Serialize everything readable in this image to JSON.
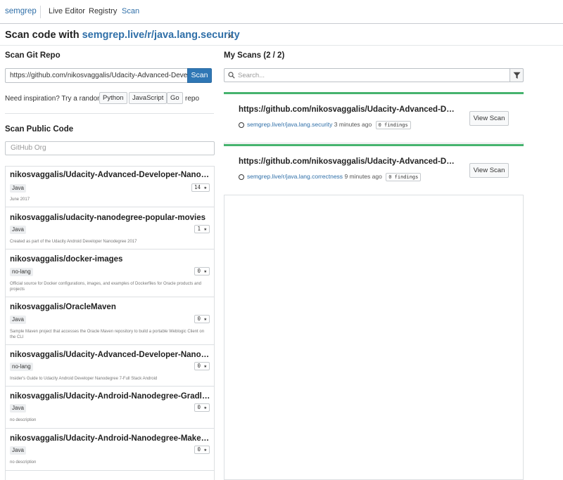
{
  "nav": {
    "brand": "semgrep",
    "links": [
      "Live Editor",
      "Registry",
      "Scan"
    ],
    "active": "Scan"
  },
  "header": {
    "prefix": "Scan code with",
    "link": "semgrep.live/r/java.lang.security",
    "close": "×"
  },
  "git_repo": {
    "title": "Scan Git Repo",
    "input_value": "https://github.com/nikosvaggalis/Udacity-Advanced-Develo",
    "scan_label": "Scan",
    "inspiration": "Need inspiration? Try a random",
    "languages": [
      "Python",
      "JavaScript",
      "Go"
    ],
    "repo_word": "repo"
  },
  "public_code": {
    "title": "Scan Public Code",
    "org_placeholder": "GitHub Org",
    "repos": [
      {
        "name": "nikosvaggalis/Udacity-Advanced-Developer-Nanodegree-Capstone",
        "lang": "Java",
        "stars": "14 ★",
        "desc": "June 2017"
      },
      {
        "name": "nikosvaggalis/udacity-nanodegree-popular-movies",
        "lang": "Java",
        "stars": "1 ★",
        "desc": "Created as part of the Udacity Android Developer Nanodegree 2017"
      },
      {
        "name": "nikosvaggalis/docker-images",
        "lang": "no-lang",
        "stars": "0 ★",
        "desc": "Official source for Docker configurations, images, and examples of Dockerfiles for Oracle products and projects"
      },
      {
        "name": "nikosvaggalis/OracleMaven",
        "lang": "Java",
        "stars": "0 ★",
        "desc": "Sample Maven project that accesses the Oracle Maven repository to build a portable Weblogic Client on the CLI"
      },
      {
        "name": "nikosvaggalis/Udacity-Advanced-Developer-Nanodegree-Guide",
        "lang": "no-lang",
        "stars": "0 ★",
        "desc": "Insider's Guide to Udacity Android Developer Nanodegree 7-Full Stack Android"
      },
      {
        "name": "nikosvaggalis/Udacity-Android-Nanodegree-Gradle-For-Android",
        "lang": "Java",
        "stars": "0 ★",
        "desc": "no description"
      },
      {
        "name": "nikosvaggalis/Udacity-Android-Nanodegree-Make-Your-App-Material",
        "lang": "Java",
        "stars": "0 ★",
        "desc": "no description"
      }
    ]
  },
  "my_scans": {
    "title": "My Scans (2 / 2)",
    "search_placeholder": "Search...",
    "scans": [
      {
        "url": "https://github.com/nikosvaggalis/Udacity-Advanced-Developer-Nanodegree-Capstone",
        "rule": "semgrep.live/r/java.lang.security",
        "time": "3 minutes ago",
        "findings": "0 findings",
        "action": "View Scan"
      },
      {
        "url": "https://github.com/nikosvaggalis/Udacity-Advanced-Developer-Nanodegree-Capstone",
        "rule": "semgrep.live/r/java.lang.correctness",
        "time": "9 minutes ago",
        "findings": "0 findings",
        "action": "View Scan"
      }
    ]
  },
  "colors": {
    "accent": "#2f6fa8",
    "primary_button": "#2f77b5",
    "success_bar": "#46b36e"
  }
}
